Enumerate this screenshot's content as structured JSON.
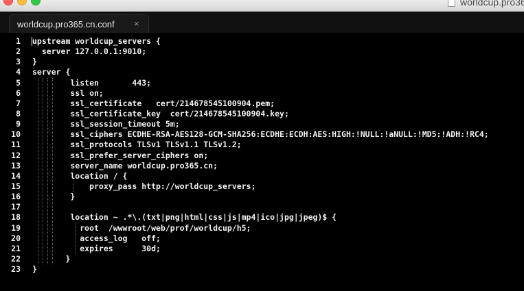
{
  "window": {
    "title": "worldcup.pro365.cn.conf",
    "title_visible": "worldcup.pro36"
  },
  "tabs": [
    {
      "label": "worldcup.pro365.cn.conf",
      "close_label": "×",
      "active": true
    }
  ],
  "editor": {
    "line_numbers": [
      "1",
      "2",
      "3",
      "4",
      "5",
      "6",
      "7",
      "8",
      "9",
      "10",
      "11",
      "12",
      "13",
      "14",
      "15",
      "16",
      "17",
      "18",
      "19",
      "20",
      "21",
      "22",
      "23"
    ],
    "lines": [
      "upstream worldcup_servers {",
      "  server 127.0.0.1:9010;",
      "}",
      "server {",
      "        listen       443;",
      "        ssl on;",
      "        ssl_certificate   cert/214678545100904.pem;",
      "        ssl_certificate_key  cert/214678545100904.key;",
      "        ssl_session_timeout 5m;",
      "        ssl_ciphers ECDHE-RSA-AES128-GCM-SHA256:ECDHE:ECDH:AES:HIGH:!NULL:!aNULL:!MD5:!ADH:!RC4;",
      "        ssl_protocols TLSv1 TLSv1.1 TLSv1.2;",
      "        ssl_prefer_server_ciphers on;",
      "        server_name worldcup.pro365.cn;",
      "        location / {",
      "            proxy_pass http://worldcup_servers;",
      "        }",
      "",
      "        location ~ .*\\.(txt|png|html|css|js|mp4|ico|jpg|jpeg)$ {",
      "          root  /wwwroot/web/prof/worldcup/h5;",
      "          access_log   off;",
      "          expires      30d;",
      "       }",
      "}"
    ]
  },
  "colors": {
    "background": "#000000",
    "text": "#f2f2f2",
    "tab_background": "#191919",
    "tabbar_background": "#111111"
  }
}
